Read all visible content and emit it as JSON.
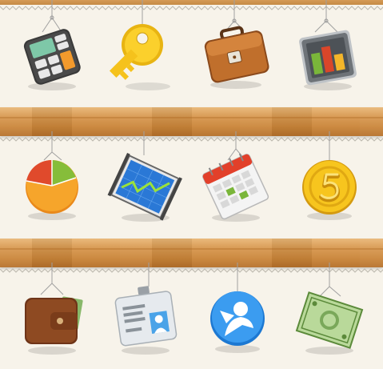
{
  "icons": [
    {
      "row": 1,
      "name": "calculator-icon"
    },
    {
      "row": 1,
      "name": "key-icon"
    },
    {
      "row": 1,
      "name": "briefcase-icon"
    },
    {
      "row": 1,
      "name": "bar-chart-icon"
    },
    {
      "row": 2,
      "name": "pie-chart-icon"
    },
    {
      "row": 2,
      "name": "line-chart-icon"
    },
    {
      "row": 2,
      "name": "calendar-icon"
    },
    {
      "row": 2,
      "name": "coin-icon"
    },
    {
      "row": 3,
      "name": "wallet-icon"
    },
    {
      "row": 3,
      "name": "id-badge-icon"
    },
    {
      "row": 3,
      "name": "user-globe-icon"
    },
    {
      "row": 3,
      "name": "banknote-icon"
    }
  ],
  "colors": {
    "background": "#f7f3ea",
    "shelf": "#d99a52",
    "string": "#9e9e9e"
  }
}
